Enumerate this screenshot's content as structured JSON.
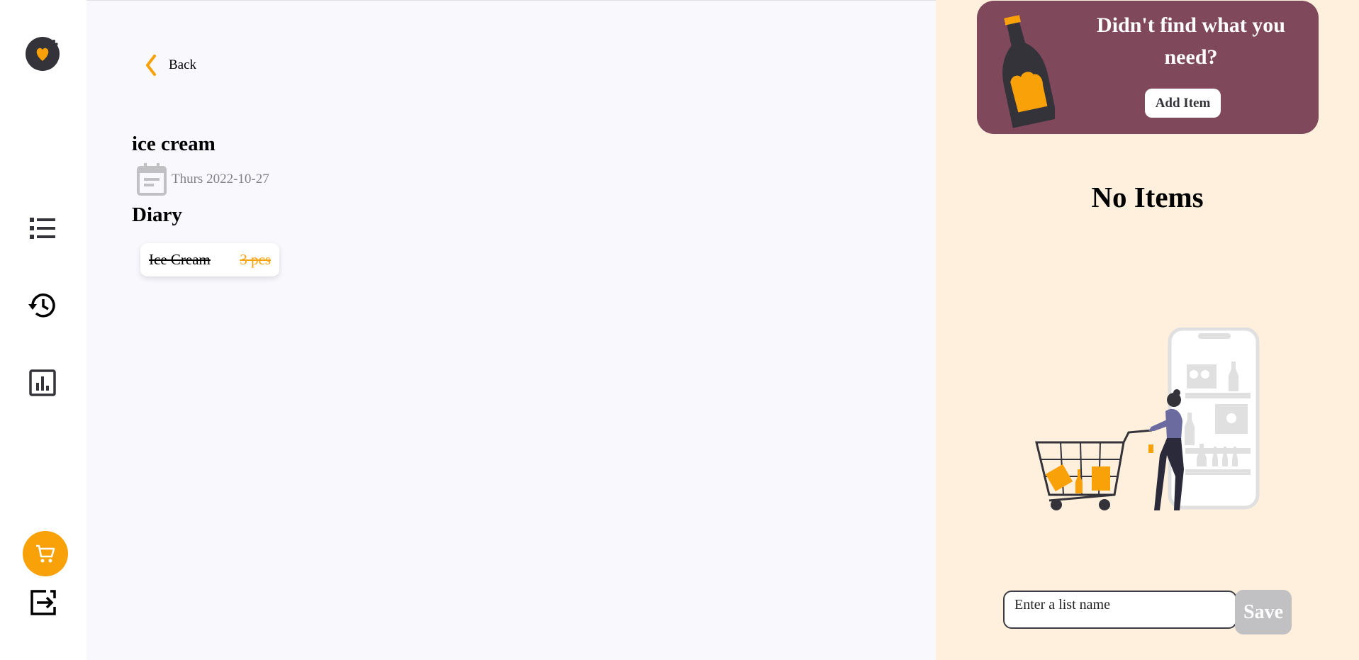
{
  "sidebar": {
    "items": [
      {
        "name": "list-icon"
      },
      {
        "name": "history-icon"
      },
      {
        "name": "statistics-icon"
      }
    ],
    "cart_color": "#f9a109"
  },
  "main": {
    "back_label": "Back",
    "list_title": "ice cream",
    "date": "Thurs 2022-10-27",
    "categories": [
      {
        "name": "Diary",
        "items": [
          {
            "name": "Ice Cream",
            "qty": "3 pcs",
            "completed": true
          }
        ]
      }
    ]
  },
  "panel": {
    "promo_text": "Didn't find what you need?",
    "add_item_label": "Add Item",
    "empty_label": "No Items",
    "input_placeholder": "Enter a list name",
    "save_label": "Save",
    "promo_bg": "#80485b",
    "panel_bg": "#fff0de"
  }
}
